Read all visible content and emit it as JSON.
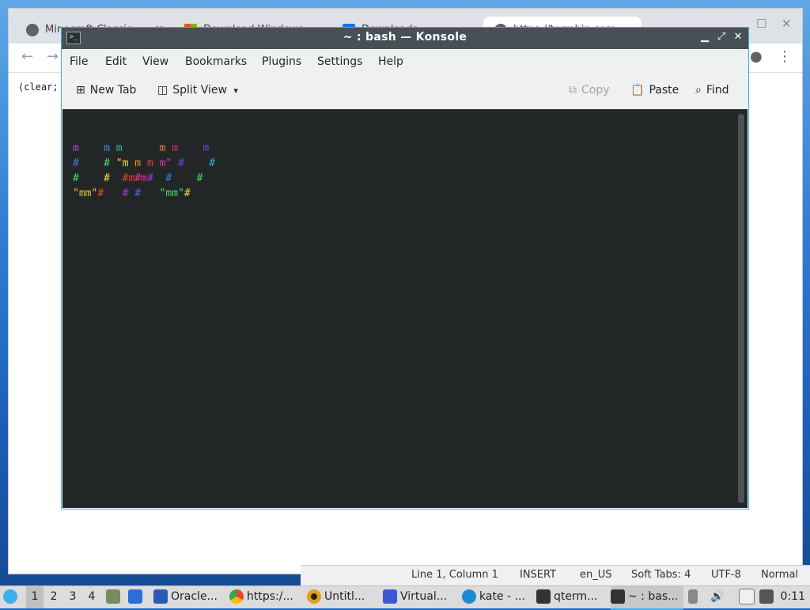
{
  "browser": {
    "tabs": [
      {
        "label": "Minecraft Classic"
      },
      {
        "label": "Download Windows"
      },
      {
        "label": "Downloads"
      },
      {
        "label": "https://termbin.com"
      }
    ],
    "content_text": "(clear;"
  },
  "editor_status": {
    "position": "Line 1, Column 1",
    "mode": "INSERT",
    "locale": "en_US",
    "tabs": "Soft Tabs: 4",
    "encoding": "UTF-8",
    "style": "Normal"
  },
  "konsole": {
    "title": "~ : bash — Konsole",
    "menu": [
      "File",
      "Edit",
      "View",
      "Bookmarks",
      "Plugins",
      "Settings",
      "Help"
    ],
    "toolbar": {
      "new_tab": "New Tab",
      "split_view": "Split View",
      "copy": "Copy",
      "paste": "Paste",
      "find": "Find"
    },
    "ascii_art": [
      [
        {
          "t": "m",
          "c": "#b04ad8"
        },
        {
          "t": "    "
        },
        {
          "t": "m",
          "c": "#3a8ee6"
        },
        {
          "t": " "
        },
        {
          "t": "m",
          "c": "#28c9a0"
        },
        {
          "t": "      "
        },
        {
          "t": "m",
          "c": "#e08a2a"
        },
        {
          "t": " "
        },
        {
          "t": "m",
          "c": "#e0365a"
        },
        {
          "t": "    "
        },
        {
          "t": "m",
          "c": "#7a3ee0"
        }
      ],
      [
        {
          "t": "#",
          "c": "#3a7de8"
        },
        {
          "t": "    "
        },
        {
          "t": "#",
          "c": "#3ee05a"
        },
        {
          "t": " "
        },
        {
          "t": "\"m",
          "c": "#e8e03a"
        },
        {
          "t": " m",
          "c": "#e8902a"
        },
        {
          "t": " m",
          "c": "#e03a4a"
        },
        {
          "t": " m\"",
          "c": "#d03aa0"
        },
        {
          "t": " "
        },
        {
          "t": "#",
          "c": "#7a3ee0"
        },
        {
          "t": "    "
        },
        {
          "t": "#",
          "c": "#28b8e0"
        }
      ],
      [
        {
          "t": "#",
          "c": "#3ee06a"
        },
        {
          "t": "    "
        },
        {
          "t": "#",
          "c": "#e8e03a"
        },
        {
          "t": "  "
        },
        {
          "t": "#m",
          "c": "#e83a3a"
        },
        {
          "t": "#m",
          "c": "#e03a8a"
        },
        {
          "t": "#",
          "c": "#a03ae0"
        },
        {
          "t": "  "
        },
        {
          "t": "#",
          "c": "#3a7de8"
        },
        {
          "t": "    "
        },
        {
          "t": "#",
          "c": "#3ee05a"
        }
      ],
      [
        {
          "t": "\"mm\"",
          "c": "#e0c83a"
        },
        {
          "t": "#",
          "c": "#e84a2a"
        },
        {
          "t": "   "
        },
        {
          "t": "#",
          "c": "#a03ae0"
        },
        {
          "t": " "
        },
        {
          "t": "#",
          "c": "#3a6ee8"
        },
        {
          "t": "   "
        },
        {
          "t": "\"mm\"",
          "c": "#3ee06a"
        },
        {
          "t": "#",
          "c": "#e0e03a"
        }
      ]
    ]
  },
  "taskbar": {
    "desktops": [
      "1",
      "2",
      "3",
      "4"
    ],
    "items": [
      {
        "label": "Oracle..."
      },
      {
        "label": "https:/..."
      },
      {
        "label": "Untitl..."
      },
      {
        "label": "Virtual..."
      },
      {
        "label": "kate - ..."
      },
      {
        "label": "qterm..."
      },
      {
        "label": "~ : bas..."
      }
    ],
    "clock": "0:11"
  }
}
